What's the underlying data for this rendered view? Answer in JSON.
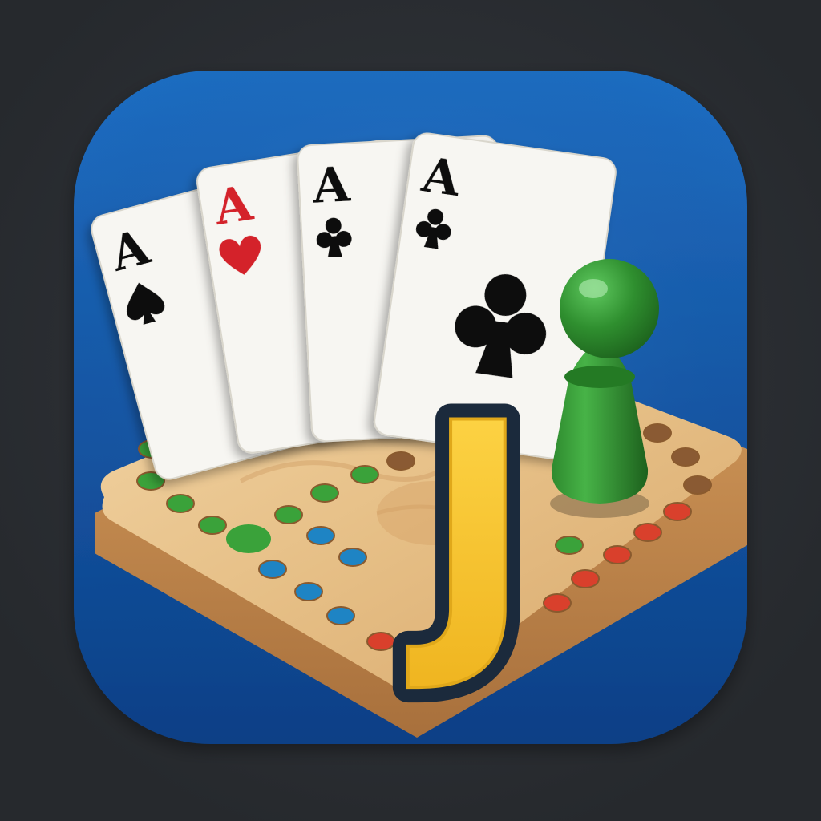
{
  "app": {
    "name": "",
    "colors": {
      "background": "#2a2d32",
      "tile_top": "#1f6fc4",
      "tile_bottom": "#0c3f86",
      "board_light": "#e9c48e",
      "board_dark": "#c8945a",
      "peg_green": "#3aa23a",
      "peg_blue": "#1e84c4",
      "peg_red": "#d9402c",
      "peg_brown": "#8a5a33",
      "pawn_green": "#2f8f2f",
      "letter_yellow": "#f7c93a",
      "letter_outline": "#1b2a3c",
      "card_face": "#f7f6f2",
      "suit_black": "#111111",
      "suit_red": "#d4202c"
    }
  },
  "icon": {
    "cards": [
      {
        "rank": "A",
        "suit": "spade",
        "color": "#111111"
      },
      {
        "rank": "A",
        "suit": "heart",
        "color": "#d4202c"
      },
      {
        "rank": "A",
        "suit": "club",
        "color": "#111111"
      },
      {
        "rank": "A",
        "suit": "club",
        "color": "#111111"
      }
    ],
    "letter": "J",
    "pawn": "green-pawn",
    "board": "cribbage-board"
  }
}
